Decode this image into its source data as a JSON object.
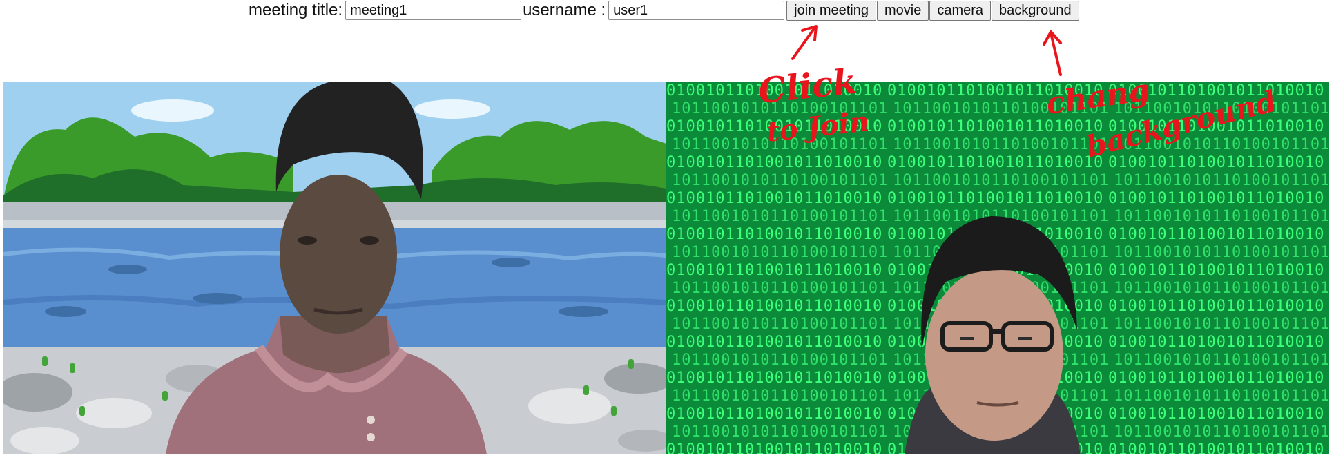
{
  "toolbar": {
    "meeting_title_label": "meeting title:",
    "meeting_title_value": "meeting1",
    "username_label": "username :",
    "username_value": "user1",
    "join_button": "join meeting",
    "movie_button": "movie",
    "camera_button": "camera",
    "background_button": "background"
  },
  "annotations": {
    "join_hint_line1": "Click",
    "join_hint_line2": "to Join",
    "background_hint_line1": "chang",
    "background_hint_line2": "background"
  },
  "colors": {
    "annotation": "#e8161c",
    "matrix_green": "#0b8a3a",
    "matrix_digit": "#3cff7a",
    "river_blue": "#5a8fcf",
    "sky_blue": "#9fd0f0",
    "forest_green": "#3a9a2a"
  },
  "matrix_digits": "0100101101001011010010110100101101001011010010110100101101001011"
}
